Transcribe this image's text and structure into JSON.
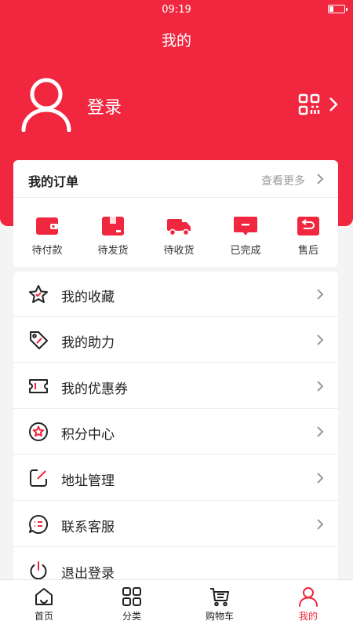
{
  "status_bar": {
    "time": "09:19"
  },
  "header": {
    "title": "我的",
    "login_label": "登录"
  },
  "orders": {
    "title": "我的订单",
    "more_label": "查看更多",
    "items": [
      {
        "label": "待付款",
        "icon": "wallet-icon"
      },
      {
        "label": "待发货",
        "icon": "box-icon"
      },
      {
        "label": "待收货",
        "icon": "truck-icon"
      },
      {
        "label": "已完成",
        "icon": "message-done-icon"
      },
      {
        "label": "售后",
        "icon": "return-icon"
      }
    ]
  },
  "menu": [
    {
      "label": "我的收藏",
      "icon": "star-icon"
    },
    {
      "label": "我的助力",
      "icon": "tag-icon"
    },
    {
      "label": "我的优惠券",
      "icon": "coupon-icon"
    },
    {
      "label": "积分中心",
      "icon": "points-icon"
    },
    {
      "label": "地址管理",
      "icon": "edit-icon"
    },
    {
      "label": "联系客服",
      "icon": "chat-icon"
    },
    {
      "label": "退出登录",
      "icon": "power-icon"
    }
  ],
  "tabbar": [
    {
      "label": "首页",
      "icon": "home-icon"
    },
    {
      "label": "分类",
      "icon": "grid-icon"
    },
    {
      "label": "购物车",
      "icon": "cart-icon"
    },
    {
      "label": "我的",
      "icon": "user-icon",
      "active": true
    }
  ],
  "colors": {
    "accent": "#f0273f",
    "background": "#f4f4f4"
  }
}
